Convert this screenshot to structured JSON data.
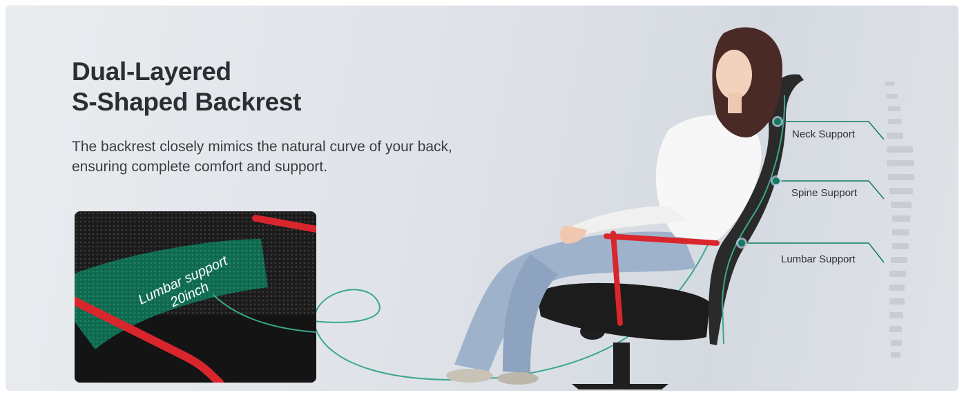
{
  "heading": {
    "line1": "Dual-Layered",
    "line2": "S-Shaped Backrest"
  },
  "description": {
    "line1": "The backrest closely mimics the natural curve of your back,",
    "line2": "ensuring complete comfort and support."
  },
  "inset": {
    "label_line1": "Lumbar support",
    "label_line2": "20inch"
  },
  "callouts": {
    "neck": "Neck Support",
    "spine": "Spine Support",
    "lumbar": "Lumbar Support"
  },
  "colors": {
    "accent_teal": "#0f7b5e",
    "curve_line": "#3aa78c",
    "armrest_red": "#d8262c",
    "mesh": "#1b1b1b"
  }
}
